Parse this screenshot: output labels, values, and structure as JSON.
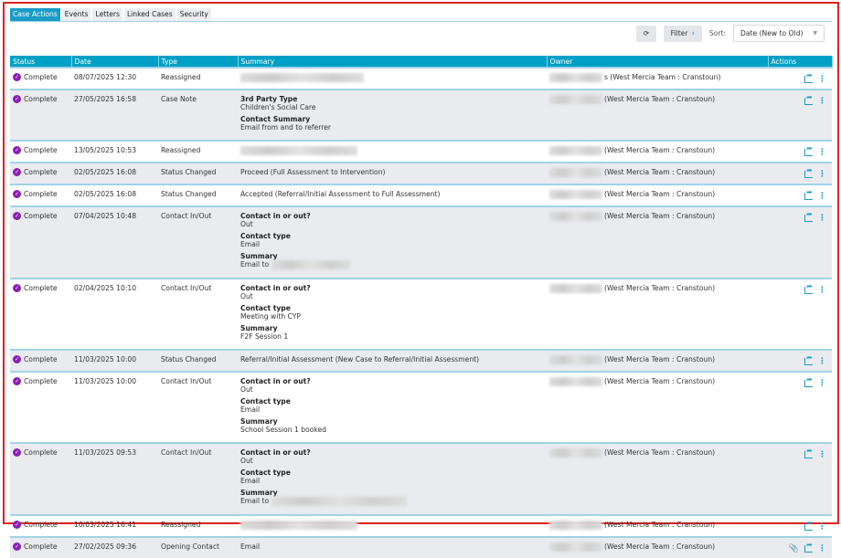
{
  "tabs": [
    {
      "label": "Case Actions",
      "active": true
    },
    {
      "label": "Events"
    },
    {
      "label": "Letters"
    },
    {
      "label": "Linked Cases"
    },
    {
      "label": "Security"
    }
  ],
  "toolbar": {
    "refresh_icon": "refresh-icon",
    "filter_label": "Filter",
    "sort_label": "Sort:",
    "sort_value": "Date (New to Old)"
  },
  "columns": [
    "Status",
    "Date",
    "Type",
    "Summary",
    "Owner",
    "Actions"
  ],
  "rows": [
    {
      "status": "Complete",
      "date": "08/07/2025 12:30",
      "type": "Reassigned",
      "summary_blur": true,
      "owner": "s (West Mercia Team : Cranstoun)"
    },
    {
      "status": "Complete",
      "date": "27/05/2025 16:58",
      "type": "Case Note",
      "fields": [
        {
          "label": "3rd Party Type",
          "value": "Children's Social Care"
        },
        {
          "label": "Contact Summary",
          "value": "Email from and to referrer"
        }
      ],
      "owner": "(West Mercia Team : Cranstoun)"
    },
    {
      "status": "Complete",
      "date": "13/05/2025 10:53",
      "type": "Reassigned",
      "summary_blur": true,
      "owner": "(West Mercia Team : Cranstoun)"
    },
    {
      "status": "Complete",
      "date": "02/05/2025 16:08",
      "type": "Status Changed",
      "summary": "Proceed (Full Assessment to Intervention)",
      "owner": "(West Mercia Team : Cranstoun)"
    },
    {
      "status": "Complete",
      "date": "02/05/2025 16:08",
      "type": "Status Changed",
      "summary": "Accepted (Referral/Initial Assessment to Full Assessment)",
      "owner": "(West Mercia Team : Cranstoun)"
    },
    {
      "status": "Complete",
      "date": "07/04/2025 10:48",
      "type": "Contact In/Out",
      "fields": [
        {
          "label": "Contact in or out?",
          "value": "Out"
        },
        {
          "label": "Contact type",
          "value": "Email"
        },
        {
          "label": "Summary",
          "value": "Email to",
          "blur": true
        }
      ],
      "owner": "(West Mercia Team : Cranstoun)"
    },
    {
      "status": "Complete",
      "date": "02/04/2025 10:10",
      "type": "Contact In/Out",
      "fields": [
        {
          "label": "Contact in or out?",
          "value": "Out"
        },
        {
          "label": "Contact type",
          "value": "Meeting with CYP"
        },
        {
          "label": "Summary",
          "value": "F2F Session 1"
        }
      ],
      "owner": "(West Mercia Team : Cranstoun)"
    },
    {
      "status": "Complete",
      "date": "11/03/2025 10:00",
      "type": "Status Changed",
      "summary": "Referral/Initial Assessment (New Case to Referral/Initial Assessment)",
      "owner": "(West Mercia Team : Cranstoun)"
    },
    {
      "status": "Complete",
      "date": "11/03/2025 10:00",
      "type": "Contact In/Out",
      "fields": [
        {
          "label": "Contact in or out?",
          "value": "Out"
        },
        {
          "label": "Contact type",
          "value": "Email"
        },
        {
          "label": "Summary",
          "value": "School Session 1 booked"
        }
      ],
      "owner": "(West Mercia Team : Cranstoun)"
    },
    {
      "status": "Complete",
      "date": "11/03/2025 09:53",
      "type": "Contact In/Out",
      "fields": [
        {
          "label": "Contact in or out?",
          "value": "Out"
        },
        {
          "label": "Contact type",
          "value": "Email"
        },
        {
          "label": "Summary",
          "value": "Email to",
          "blur": true,
          "blur_wide": true
        }
      ],
      "owner": "(West Mercia Team : Cranstoun)"
    },
    {
      "status": "Complete",
      "date": "10/03/2025 16:41",
      "type": "Reassigned",
      "summary_blur": true,
      "owner": "(West Mercia Team : Cranstoun)"
    },
    {
      "status": "Complete",
      "date": "27/02/2025 09:36",
      "type": "Opening Contact",
      "summary": "Email",
      "owner": "(West Mercia Team : Cranstoun)",
      "attachment": true
    }
  ]
}
